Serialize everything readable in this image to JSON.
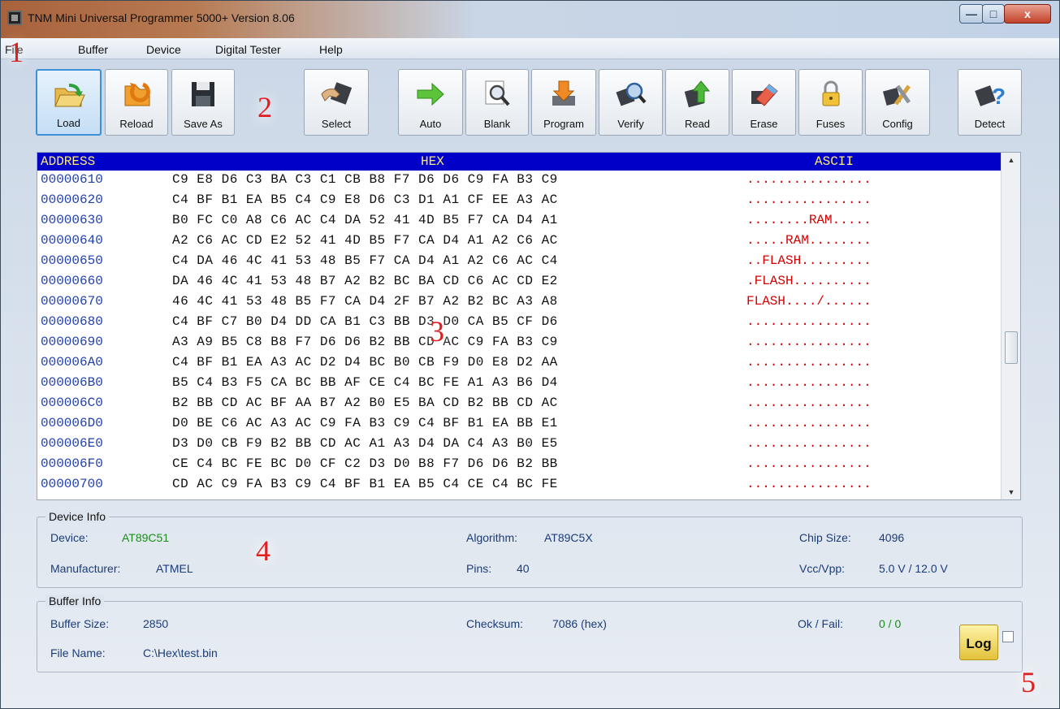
{
  "window": {
    "title": "TNM Mini Universal Programmer 5000+   Version 8.06",
    "controls": {
      "minimize": "—",
      "maximize": "□",
      "close": "x"
    }
  },
  "menu": [
    "File",
    "Buffer",
    "Device",
    "Digital Tester",
    "Help"
  ],
  "toolbar": [
    {
      "label": "Load",
      "icon": "folder-open-icon"
    },
    {
      "label": "Reload",
      "icon": "reload-icon"
    },
    {
      "label": "Save As",
      "icon": "floppy-disk-icon"
    },
    {
      "label": "Select",
      "icon": "chip-select-icon"
    },
    {
      "label": "Auto",
      "icon": "green-arrow-icon"
    },
    {
      "label": "Blank",
      "icon": "magnifier-icon"
    },
    {
      "label": "Program",
      "icon": "download-arrow-icon"
    },
    {
      "label": "Verify",
      "icon": "chip-magnifier-icon"
    },
    {
      "label": "Read",
      "icon": "chip-up-arrow-icon"
    },
    {
      "label": "Erase",
      "icon": "eraser-icon"
    },
    {
      "label": "Fuses",
      "icon": "padlock-icon"
    },
    {
      "label": "Config",
      "icon": "tools-icon"
    },
    {
      "label": "Detect",
      "icon": "chip-question-icon"
    }
  ],
  "hex": {
    "headers": {
      "address": "ADDRESS",
      "hex": "HEX",
      "ascii": "ASCII"
    },
    "rows": [
      {
        "addr": "00000610",
        "bytes": "C9 E8 D6 C3 BA C3 C1 CB B8 F7 D6 D6 C9 FA B3 C9",
        "ascii": "................"
      },
      {
        "addr": "00000620",
        "bytes": "C4 BF B1 EA B5 C4 C9 E8 D6 C3 D1 A1 CF EE A3 AC",
        "ascii": "................"
      },
      {
        "addr": "00000630",
        "bytes": "B0 FC C0 A8 C6 AC C4 DA 52 41 4D B5 F7 CA D4 A1",
        "ascii": "........RAM....."
      },
      {
        "addr": "00000640",
        "bytes": "A2 C6 AC CD E2 52 41 4D B5 F7 CA D4 A1 A2 C6 AC",
        "ascii": ".....RAM........"
      },
      {
        "addr": "00000650",
        "bytes": "C4 DA 46 4C 41 53 48 B5 F7 CA D4 A1 A2 C6 AC C4",
        "ascii": "..FLASH........."
      },
      {
        "addr": "00000660",
        "bytes": "DA 46 4C 41 53 48 B7 A2 B2 BC BA CD C6 AC CD E2",
        "ascii": ".FLASH.........."
      },
      {
        "addr": "00000670",
        "bytes": "46 4C 41 53 48 B5 F7 CA D4 2F B7 A2 B2 BC A3 A8",
        "ascii": "FLASH..../......"
      },
      {
        "addr": "00000680",
        "bytes": "C4 BF C7 B0 D4 DD CA B1 C3 BB D3 D0 CA B5 CF D6",
        "ascii": "................"
      },
      {
        "addr": "00000690",
        "bytes": "A3 A9 B5 C8 B8 F7 D6 D6 B2 BB CD AC C9 FA B3 C9",
        "ascii": "................"
      },
      {
        "addr": "000006A0",
        "bytes": "C4 BF B1 EA A3 AC D2 D4 BC B0 CB F9 D0 E8 D2 AA",
        "ascii": "................"
      },
      {
        "addr": "000006B0",
        "bytes": "B5 C4 B3 F5 CA BC BB AF CE C4 BC FE A1 A3 B6 D4",
        "ascii": "................"
      },
      {
        "addr": "000006C0",
        "bytes": "B2 BB CD AC BF AA B7 A2 B0 E5 BA CD B2 BB CD AC",
        "ascii": "................"
      },
      {
        "addr": "000006D0",
        "bytes": "D0 BE C6 AC A3 AC C9 FA B3 C9 C4 BF B1 EA BB E1",
        "ascii": "................"
      },
      {
        "addr": "000006E0",
        "bytes": "D3 D0 CB F9 B2 BB CD AC A1 A3 D4 DA C4 A3 B0 E5",
        "ascii": "................"
      },
      {
        "addr": "000006F0",
        "bytes": "CE C4 BC FE BC D0 CF C2 D3 D0 B8 F7 D6 D6 B2 BB",
        "ascii": "................"
      },
      {
        "addr": "00000700",
        "bytes": "CD AC C9 FA B3 C9 C4 BF B1 EA B5 C4 CE C4 BC FE",
        "ascii": "................"
      }
    ]
  },
  "device_info": {
    "title": "Device Info",
    "device_label": "Device:",
    "device_value": "AT89C51",
    "manufacturer_label": "Manufacturer:",
    "manufacturer_value": "ATMEL",
    "algorithm_label": "Algorithm:",
    "algorithm_value": "AT89C5X",
    "pins_label": "Pins:",
    "pins_value": "40",
    "chip_size_label": "Chip Size:",
    "chip_size_value": "4096",
    "vcc_label": "Vcc/Vpp:",
    "vcc_value": "5.0 V / 12.0 V"
  },
  "buffer_info": {
    "title": "Buffer Info",
    "size_label": "Buffer Size:",
    "size_value": "2850",
    "file_label": "File Name:",
    "file_value": "C:\\Hex\\test.bin",
    "checksum_label": "Checksum:",
    "checksum_value": "7086 (hex)",
    "okfail_label": "Ok / Fail:",
    "okfail_value": "0 / 0",
    "log_label": "Log"
  },
  "callouts": [
    "1",
    "2",
    "3",
    "4",
    "5"
  ]
}
